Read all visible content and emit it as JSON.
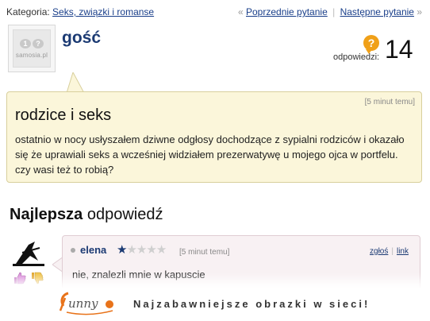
{
  "topbar": {
    "category_label": "Kategoria:",
    "category_link": "Seks, związki i romanse",
    "prev_link": "Poprzednie pytanie",
    "next_link": "Następne pytanie",
    "prev_arrow": "«",
    "next_arrow": "»",
    "separator": "|"
  },
  "question": {
    "username": "gość",
    "avatar_logo_text": "samosia.pl",
    "answers_label": "odpowiedzi:",
    "answers_count": "14",
    "time": "[5 minut temu]",
    "title": "rodzice i seks",
    "body": "ostatnio w nocy usłyszałem dziwne odgłosy dochodzące z sypialni rodziców i okazało się że uprawiali seks a wcześniej widziałem prezerwatywę u mojego ojca w portfelu. czy wasi też to robią?"
  },
  "best_answer": {
    "heading_bold": "Najlepsza",
    "heading_rest": " odpowiedź",
    "username": "elena",
    "rating": 1,
    "rating_max": 5,
    "time": "[5 minut temu]",
    "report_link": "zgłoś",
    "link_link": "link",
    "text": "nie, znalezli mnie w kapuscie"
  },
  "footer": {
    "logo_text": "funny",
    "slogan": "Najzabawniejsze obrazki w sieci!"
  },
  "colors": {
    "link_blue": "#1a3f8a",
    "question_bg": "#fbf6da",
    "answer_bg": "#f8f1f3",
    "answers_icon": "#f0a018"
  }
}
